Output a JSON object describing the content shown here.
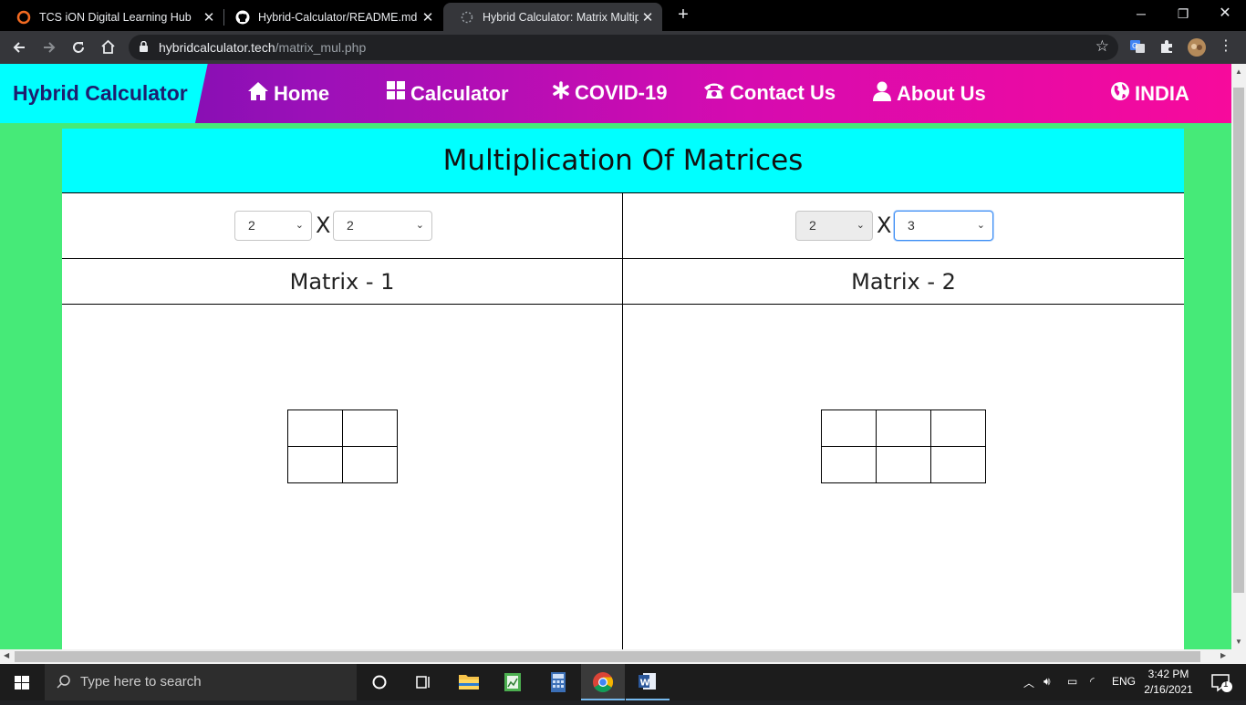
{
  "browser": {
    "tabs": [
      {
        "title": "TCS iON Digital Learning Hub",
        "active": false
      },
      {
        "title": "Hybrid-Calculator/README.md a",
        "active": false
      },
      {
        "title": "Hybrid Calculator: Matrix Multipli",
        "active": true
      }
    ],
    "url_host": "hybridcalculator.tech",
    "url_path": "/matrix_mul.php"
  },
  "site": {
    "brand": "Hybrid Calculator",
    "nav": [
      {
        "label": "Home",
        "icon": "home-icon"
      },
      {
        "label": "Calculator",
        "icon": "grid-icon"
      },
      {
        "label": "COVID-19",
        "icon": "asterisk-icon"
      },
      {
        "label": "Contact Us",
        "icon": "phone-icon"
      },
      {
        "label": "About Us",
        "icon": "user-icon"
      },
      {
        "label": "INDIA",
        "icon": "globe-icon"
      }
    ]
  },
  "page": {
    "title": "Multiplication Of Matrices",
    "times_symbol": "X",
    "matrix1": {
      "title": "Matrix - 1",
      "rows": "2",
      "cols": "2",
      "rows_count": 2,
      "cols_count": 2
    },
    "matrix2": {
      "title": "Matrix - 2",
      "rows": "2",
      "cols": "3",
      "rows_count": 2,
      "cols_count": 3,
      "rows_disabled": true
    }
  },
  "taskbar": {
    "search_placeholder": "Type here to search",
    "language": "ENG",
    "time": "3:42 PM",
    "date": "2/16/2021",
    "notifications": "1"
  },
  "colors": {
    "page_bg": "#46ea78",
    "header_cyan": "#00ffff",
    "nav_gradient_start": "#6a0dad",
    "nav_gradient_end": "#f70a9c"
  }
}
